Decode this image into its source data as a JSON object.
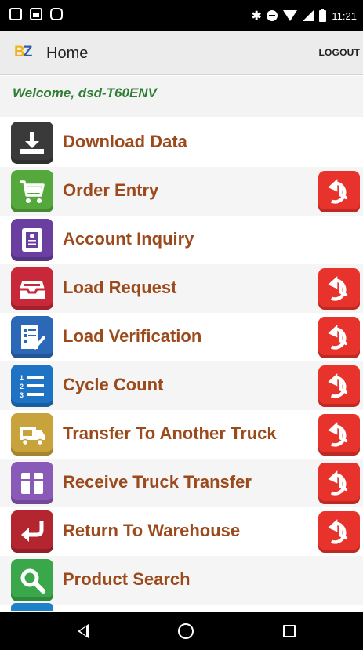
{
  "status_bar": {
    "time": "11:21",
    "icons": [
      "notification-icon",
      "photo-icon",
      "bag-icon",
      "bluetooth-icon",
      "do-not-disturb-icon",
      "wifi-icon",
      "signal-icon",
      "battery-icon"
    ]
  },
  "app_bar": {
    "logo_b": "B",
    "logo_z": "Z",
    "title": "Home",
    "logout_label": "LOGOUT"
  },
  "welcome": "Welcome, dsd-T60ENV",
  "menu": {
    "items": [
      {
        "label": "Download Data",
        "icon": "download-icon",
        "color": "#3a3a3a",
        "history": false
      },
      {
        "label": "Order Entry",
        "icon": "shopping-cart-icon",
        "color": "#55a83b",
        "history": true
      },
      {
        "label": "Account Inquiry",
        "icon": "contact-card-icon",
        "color": "#6a3fa0",
        "history": false
      },
      {
        "label": "Load Request",
        "icon": "inbox-tray-icon",
        "color": "#c8283a",
        "history": true
      },
      {
        "label": "Load Verification",
        "icon": "checklist-icon",
        "color": "#2c68b8",
        "history": true
      },
      {
        "label": "Cycle Count",
        "icon": "numbered-list-icon",
        "color": "#1f73c4",
        "history": true
      },
      {
        "label": "Transfer To Another Truck",
        "icon": "truck-transfer-icon",
        "color": "#c8a23a",
        "history": true
      },
      {
        "label": "Receive Truck Transfer",
        "icon": "package-icon",
        "color": "#8a5ab8",
        "history": true
      },
      {
        "label": "Return To Warehouse",
        "icon": "return-arrow-icon",
        "color": "#b32630",
        "history": true
      },
      {
        "label": "Product Search",
        "icon": "magnifier-icon",
        "color": "#3aa84a",
        "history": false
      }
    ],
    "history_icon": "history-icon",
    "history_color": "#e8332c"
  },
  "nav_bar": {
    "icons": [
      "back-icon",
      "home-icon",
      "recents-icon"
    ]
  }
}
